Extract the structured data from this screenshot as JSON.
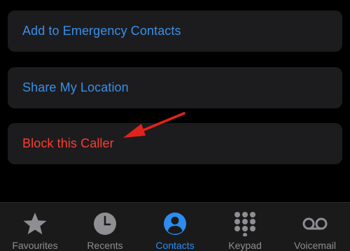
{
  "options": [
    {
      "label": "Add to Emergency Contacts",
      "color": "#3a8fe8"
    },
    {
      "label": "Share My Location",
      "color": "#3a8fe8"
    },
    {
      "label": "Block this Caller",
      "color": "#ff3b30"
    }
  ],
  "annotation": {
    "icon": "red-arrow-pointer",
    "color": "#e0241b"
  },
  "tabbar": {
    "active_index": 2,
    "active_color": "#2d8cf0",
    "inactive_color": "#8e8e93",
    "tabs": [
      {
        "label": "Favourites",
        "icon": "star-icon"
      },
      {
        "label": "Recents",
        "icon": "clock-icon"
      },
      {
        "label": "Contacts",
        "icon": "person-circle-icon"
      },
      {
        "label": "Keypad",
        "icon": "keypad-icon"
      },
      {
        "label": "Voicemail",
        "icon": "voicemail-icon"
      }
    ]
  }
}
